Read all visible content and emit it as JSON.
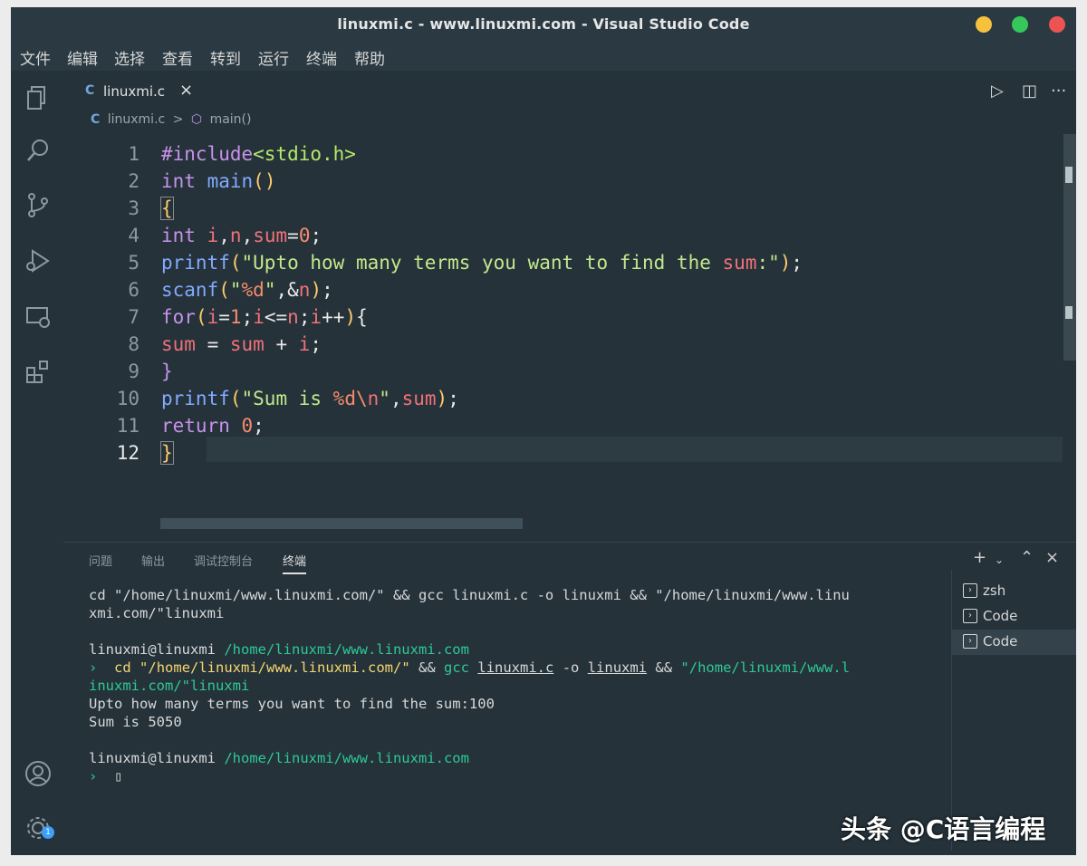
{
  "window": {
    "title": "linuxmi.c - www.linuxmi.com - Visual Studio Code"
  },
  "menu": [
    "文件",
    "编辑",
    "选择",
    "查看",
    "转到",
    "运行",
    "终端",
    "帮助"
  ],
  "tab": {
    "icon": "C",
    "name": "linuxmi.c",
    "close": "×"
  },
  "editor_actions": {
    "run": "▷",
    "split": "◫",
    "more": "···"
  },
  "breadcrumb": {
    "icon": "C",
    "file": "linuxmi.c",
    "sep": ">",
    "symbol_icon": "⬡",
    "symbol": "main()"
  },
  "code": {
    "line_numbers": [
      "1",
      "2",
      "3",
      "4",
      "5",
      "6",
      "7",
      "8",
      "9",
      "10",
      "11",
      "12"
    ],
    "lines": [
      "#include<stdio.h>",
      "int main()",
      "{",
      "int i,n,sum=0;",
      "printf(\"Upto how many terms you want to find the sum:\");",
      "scanf(\"%d\",&n);",
      "for(i=1;i<=n;i++){",
      "sum = sum + i;",
      "}",
      "printf(\"Sum is %d\\n\",sum);",
      "return 0;",
      "}"
    ]
  },
  "panel": {
    "tabs": [
      "问题",
      "输出",
      "调试控制台",
      "终端"
    ],
    "actions": {
      "add": "+",
      "dropdown": "⌄",
      "maximize": "⌃",
      "close": "×"
    },
    "terminal": {
      "cmd1": "cd \"/home/linuxmi/www.linuxmi.com/\" && gcc linuxmi.c -o linuxmi && \"/home/linuxmi/www.linu",
      "cmd1b": "xmi.com/\"linuxmi",
      "prompt_user": "linuxmi@linuxmi",
      "prompt_path": "/home/linuxmi/www.linuxmi.com",
      "arrow": "›",
      "cd": "cd",
      "cd_path": "\"/home/linuxmi/www.linuxmi.com/\"",
      "and": "&&",
      "gcc": "gcc",
      "file": "linuxmi.c",
      "flag": "-o",
      "out": "linuxmi",
      "run_path": "\"/home/linuxmi/www.l",
      "run_path2": "inuxmi.com/\"linuxmi",
      "output1": "Upto how many terms you want to find the sum:100",
      "output2": "Sum is 5050",
      "cursor": "▯"
    },
    "terminal_list": [
      "zsh",
      "Code",
      "Code"
    ]
  },
  "watermark": "头条 @C语言编程",
  "colors": {
    "background": "#25323a",
    "keyword": "#c792ea",
    "function": "#82aaff",
    "string": "#c3e88d",
    "variable": "#f07178"
  }
}
